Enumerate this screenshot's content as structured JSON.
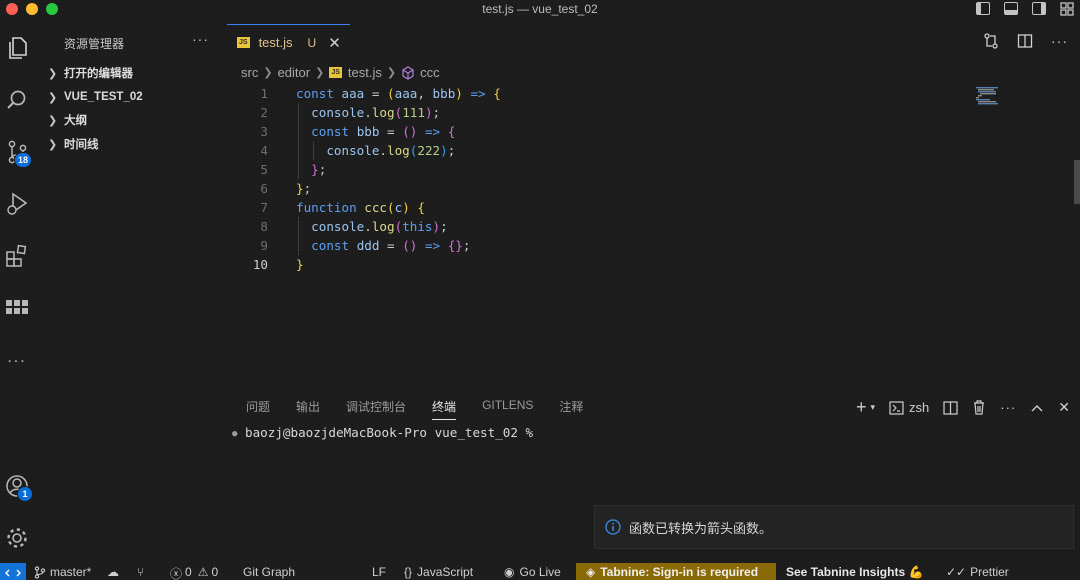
{
  "window": {
    "title": "test.js — vue_test_02"
  },
  "activity_bar": {
    "items": [
      {
        "name": "explorer",
        "icon": "files-icon"
      },
      {
        "name": "search",
        "icon": "search-icon"
      },
      {
        "name": "source-control",
        "icon": "source-control-icon",
        "badge": "18"
      },
      {
        "name": "run-debug",
        "icon": "run-debug-icon"
      },
      {
        "name": "extensions",
        "icon": "extensions-icon"
      },
      {
        "name": "grid",
        "icon": "grid-icon"
      },
      {
        "name": "more",
        "icon": "more-icon",
        "label": "..."
      }
    ],
    "accounts": {
      "icon": "account-icon",
      "badge": "1"
    },
    "manage": {
      "icon": "gear-icon"
    }
  },
  "sidebar": {
    "title": "资源管理器",
    "more": "···",
    "sections": [
      {
        "label": "打开的编辑器"
      },
      {
        "label": "VUE_TEST_02"
      },
      {
        "label": "大纲"
      },
      {
        "label": "时间线"
      }
    ]
  },
  "editor": {
    "tab": {
      "icon_text": "JS",
      "name": "test.js",
      "status": "U",
      "close": "✕"
    },
    "breadcrumb": [
      "src",
      "editor",
      "test.js",
      "ccc"
    ],
    "lines": [
      {
        "n": "1",
        "tokens": [
          [
            "k",
            "const"
          ],
          [
            "p",
            " "
          ],
          [
            "v",
            "aaa"
          ],
          [
            "p",
            " = "
          ],
          [
            "y",
            "("
          ],
          [
            "v",
            "aaa"
          ],
          [
            "p",
            ", "
          ],
          [
            "v",
            "bbb"
          ],
          [
            "y",
            ")"
          ],
          [
            "p",
            " "
          ],
          [
            "k",
            "=>"
          ],
          [
            "p",
            " "
          ],
          [
            "y",
            "{"
          ]
        ]
      },
      {
        "n": "2",
        "tokens": [
          [
            "p",
            "  "
          ],
          [
            "v",
            "console"
          ],
          [
            "p",
            "."
          ],
          [
            "f",
            "log"
          ],
          [
            "m",
            "("
          ],
          [
            "n",
            "111"
          ],
          [
            "m",
            ")"
          ],
          [
            "p",
            ";"
          ]
        ]
      },
      {
        "n": "3",
        "tokens": [
          [
            "p",
            "  "
          ],
          [
            "k",
            "const"
          ],
          [
            "p",
            " "
          ],
          [
            "v",
            "bbb"
          ],
          [
            "p",
            " = "
          ],
          [
            "m",
            "()"
          ],
          [
            "p",
            " "
          ],
          [
            "k",
            "=>"
          ],
          [
            "p",
            " "
          ],
          [
            "m",
            "{"
          ]
        ]
      },
      {
        "n": "4",
        "tokens": [
          [
            "p",
            "    "
          ],
          [
            "v",
            "console"
          ],
          [
            "p",
            "."
          ],
          [
            "f",
            "log"
          ],
          [
            "b",
            "("
          ],
          [
            "n",
            "222"
          ],
          [
            "b",
            ")"
          ],
          [
            "p",
            ";"
          ]
        ]
      },
      {
        "n": "5",
        "tokens": [
          [
            "p",
            "  "
          ],
          [
            "m",
            "}"
          ],
          [
            "p",
            ";"
          ]
        ]
      },
      {
        "n": "6",
        "tokens": [
          [
            "y",
            "}"
          ],
          [
            "p",
            ";"
          ]
        ]
      },
      {
        "n": "7",
        "tokens": [
          [
            "k",
            "function"
          ],
          [
            "p",
            " "
          ],
          [
            "f",
            "ccc"
          ],
          [
            "y",
            "("
          ],
          [
            "v",
            "c"
          ],
          [
            "y",
            ")"
          ],
          [
            "p",
            " "
          ],
          [
            "y",
            "{"
          ]
        ]
      },
      {
        "n": "8",
        "tokens": [
          [
            "p",
            "  "
          ],
          [
            "v",
            "console"
          ],
          [
            "p",
            "."
          ],
          [
            "f",
            "log"
          ],
          [
            "m",
            "("
          ],
          [
            "k",
            "this"
          ],
          [
            "m",
            ")"
          ],
          [
            "p",
            ";"
          ]
        ]
      },
      {
        "n": "9",
        "tokens": [
          [
            "p",
            "  "
          ],
          [
            "k",
            "const"
          ],
          [
            "p",
            " "
          ],
          [
            "v",
            "ddd"
          ],
          [
            "p",
            " = "
          ],
          [
            "m",
            "()"
          ],
          [
            "p",
            " "
          ],
          [
            "k",
            "=>"
          ],
          [
            "p",
            " "
          ],
          [
            "m",
            "{}"
          ],
          [
            "p",
            ";"
          ]
        ]
      },
      {
        "n": "10",
        "tokens": [
          [
            "y",
            "}"
          ]
        ],
        "current": true
      }
    ]
  },
  "panel": {
    "tabs": [
      "问题",
      "输出",
      "调试控制台",
      "终端",
      "GITLENS",
      "注释"
    ],
    "active_tab": "终端",
    "shell": "zsh",
    "prompt": "baozj@baozjdeMacBook-Pro vue_test_02 %"
  },
  "notification": {
    "icon": "info-icon",
    "text": "函数已转换为箭头函数。"
  },
  "status_bar": {
    "branch": "master*",
    "errors": "0",
    "warnings": "0",
    "git_graph": "Git Graph",
    "eol": "LF",
    "language": "JavaScript",
    "go_live": "Go Live",
    "tabnine": "Tabnine: Sign-in is required",
    "tabnine_insights": "See Tabnine Insights 💪",
    "prettier": "Prettier"
  },
  "colors": {
    "accent": "#0b6dd8",
    "tab_modified": "#e2c08d",
    "tabnine_bg": "#8a6a07",
    "keyword": "#5c9ff2",
    "function": "#dcd88a",
    "number": "#b5ce8a"
  }
}
